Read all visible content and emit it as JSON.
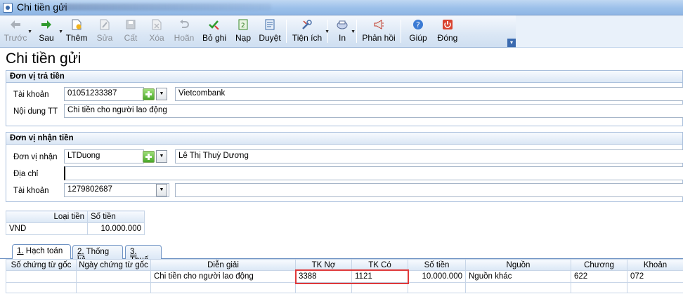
{
  "window": {
    "title": "Chi tiền gửi"
  },
  "toolbar": {
    "items": [
      {
        "label": "Trước",
        "icon": "arrow-left-icon",
        "disabled": true
      },
      {
        "label": "Sau",
        "icon": "arrow-right-icon"
      },
      {
        "label": "Thêm",
        "icon": "add-document-icon"
      },
      {
        "label": "Sửa",
        "icon": "edit-icon",
        "disabled": true
      },
      {
        "label": "Cất",
        "icon": "save-icon",
        "disabled": true
      },
      {
        "label": "Xóa",
        "icon": "delete-icon",
        "disabled": true
      },
      {
        "label": "Hoãn",
        "icon": "undo-icon",
        "disabled": true
      },
      {
        "label": "Bỏ ghi",
        "icon": "unpost-icon"
      },
      {
        "label": "Nạp",
        "icon": "reload-icon"
      },
      {
        "label": "Duyệt",
        "icon": "browse-icon"
      },
      {
        "label": "Tiện ích",
        "icon": "tools-icon"
      },
      {
        "label": "In",
        "icon": "print-icon"
      },
      {
        "label": "Phản hồi",
        "icon": "megaphone-icon"
      },
      {
        "label": "Giúp",
        "icon": "help-icon"
      },
      {
        "label": "Đóng",
        "icon": "power-icon"
      }
    ]
  },
  "page": {
    "title": "Chi tiền gửi"
  },
  "payer": {
    "header": "Đơn vị trả tiền",
    "account_label": "Tài khoản",
    "account_value": "01051233387",
    "bank_name": "Vietcombank",
    "content_label": "Nội dung TT",
    "content_value": "Chi tiền cho người lao động"
  },
  "payee": {
    "header": "Đơn vị nhận tiền",
    "unit_label": "Đơn vị nhận",
    "unit_code": "LTDuong",
    "unit_name": "Lê Thị Thuỳ Dương",
    "address_label": "Địa chỉ",
    "address_value": "",
    "account_label": "Tài khoản",
    "account_value": "1279802687",
    "bank_value": ""
  },
  "currency": {
    "headers": [
      "Loại tiền",
      "Số tiền"
    ],
    "currency_value": "VND",
    "amount_value": "10.000.000"
  },
  "tabs": [
    {
      "key": "1.",
      "label": " Hạch toán"
    },
    {
      "key": "2.",
      "label": " Thống kê"
    },
    {
      "key": "3.",
      "label": " Thuế"
    }
  ],
  "detail_grid": {
    "headers": [
      "Số chứng từ gốc",
      "Ngày chứng từ gốc",
      "Diễn giải",
      "TK Nợ",
      "TK Có",
      "Số tiền",
      "Nguồn",
      "Chương",
      "Khoản"
    ],
    "rows": [
      [
        "",
        "",
        "Chi tiền cho người lao động",
        "3388",
        "1121",
        "10.000.000",
        "Nguồn khác",
        "622",
        "072"
      ]
    ]
  },
  "colors": {
    "highlight": "#e0393a",
    "accent": "#6f93c4"
  }
}
